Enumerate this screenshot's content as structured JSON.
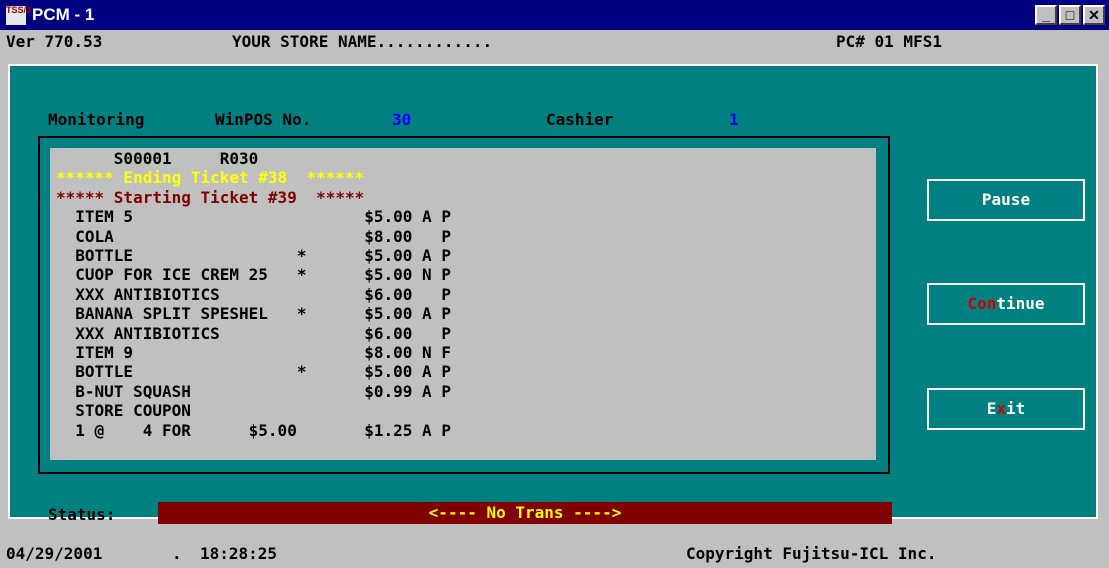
{
  "window": {
    "title": "PCM - 1",
    "icon_text": "TSS/3",
    "controls": {
      "minimize": "_",
      "maximize": "□",
      "close": "✕"
    }
  },
  "header": {
    "version": "Ver 770.53",
    "store_name": "YOUR STORE NAME............",
    "pc_id": "PC# 01 MFS1"
  },
  "monitor": {
    "label": "Monitoring",
    "winpos_label": "WinPOS No.",
    "winpos_value": "30",
    "cashier_label": "Cashier",
    "cashier_value": "1"
  },
  "receipt": {
    "lines": [
      {
        "text": "      S00001     R030",
        "style": "normal"
      },
      {
        "text": "****** Ending Ticket #38  ******",
        "style": "yellow"
      },
      {
        "text": "***** Starting Ticket #39  *****",
        "style": "red"
      },
      {
        "text": "  ITEM 5                        $5.00 A P",
        "style": "normal"
      },
      {
        "text": "  COLA                          $8.00   P",
        "style": "normal"
      },
      {
        "text": "  BOTTLE                 *      $5.00 A P",
        "style": "normal"
      },
      {
        "text": "  CUOP FOR ICE CREM 25   *      $5.00 N P",
        "style": "normal"
      },
      {
        "text": "  XXX ANTIBIOTICS               $6.00   P",
        "style": "normal"
      },
      {
        "text": "  BANANA SPLIT SPESHEL   *      $5.00 A P",
        "style": "normal"
      },
      {
        "text": "  XXX ANTIBIOTICS               $6.00   P",
        "style": "normal"
      },
      {
        "text": "  ITEM 9                        $8.00 N F",
        "style": "normal"
      },
      {
        "text": "  BOTTLE                 *      $5.00 A P",
        "style": "normal"
      },
      {
        "text": "  B-NUT SQUASH                  $0.99 A P",
        "style": "normal"
      },
      {
        "text": "  STORE COUPON",
        "style": "normal"
      },
      {
        "text": "  1 @    4 FOR      $5.00       $1.25 A P",
        "style": "normal"
      }
    ]
  },
  "buttons": {
    "pause": "Pause",
    "continue_accent": "Con",
    "continue_rest": "tinue",
    "exit_pre": "E",
    "exit_accent": "x",
    "exit_post": "it"
  },
  "status": {
    "label": "Status:",
    "value": "<---- No Trans ---->"
  },
  "footer": {
    "date": "04/29/2001",
    "separator": ".",
    "time": "18:28:25",
    "copyright": "Copyright Fujitsu-ICL Inc."
  },
  "colors": {
    "title_bar": "#000080",
    "panel": "#008080",
    "receipt_bg": "#c0c0c0",
    "status_bg": "#800000",
    "status_text": "#ffff00",
    "value_text": "#0000ff",
    "accent_red": "#cc0000"
  }
}
